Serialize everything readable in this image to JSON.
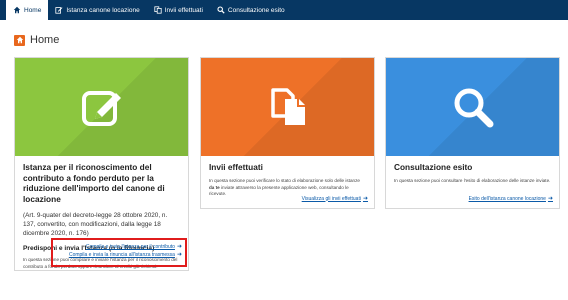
{
  "nav": {
    "items": [
      {
        "label": "Home",
        "icon": "home-icon"
      },
      {
        "label": "Istanza canone locazione",
        "icon": "edit-icon"
      },
      {
        "label": "Invii effettuati",
        "icon": "files-icon"
      },
      {
        "label": "Consultazione esito",
        "icon": "search-icon"
      }
    ]
  },
  "page": {
    "title": "Home"
  },
  "cards": {
    "istanza": {
      "title": "Istanza per il riconoscimento del contributo a fondo perduto per la riduzione dell'importo del canone di locazione",
      "note": "(Art. 9-quater del decreto-legge 28 ottobre 2020, n. 137, convertito, con modificazioni, dalla legge 18 dicembre 2020, n. 176)",
      "subtitle": "Predisponi e invia l'Istanza (o la Rinuncia)",
      "description": "In questa sezione puoi compilare e inviare l'istanza per il riconoscimento del contributo a fondo perduto oppure rinunciare ai crediti già richiesti.",
      "link1": "Compila e invia l'istanza per il contributo",
      "link2": "Compila e invia la rinuncia all'istanza trasmessa"
    },
    "invii": {
      "title": "Invii effettuati",
      "description_a": "In questa sezione puoi verificare lo stato di elaborazione solo delle istanze ",
      "description_bold": "da te",
      "description_b": " inviate attraverso la presente applicazione web, consultando le ricevute.",
      "link": "Visualizza gli invii effettuati"
    },
    "consultazione": {
      "title": "Consultazione esito",
      "description": "In questa sezione puoi consultare l'esito di elaborazione delle istanze inviate.",
      "link": "Esito dell'istanza canone locazione"
    }
  },
  "colors": {
    "nav_bg": "#073763",
    "green": "#8cc63f",
    "orange": "#ee7128",
    "blue": "#3a8fde",
    "highlight_border": "#e01c1c"
  }
}
